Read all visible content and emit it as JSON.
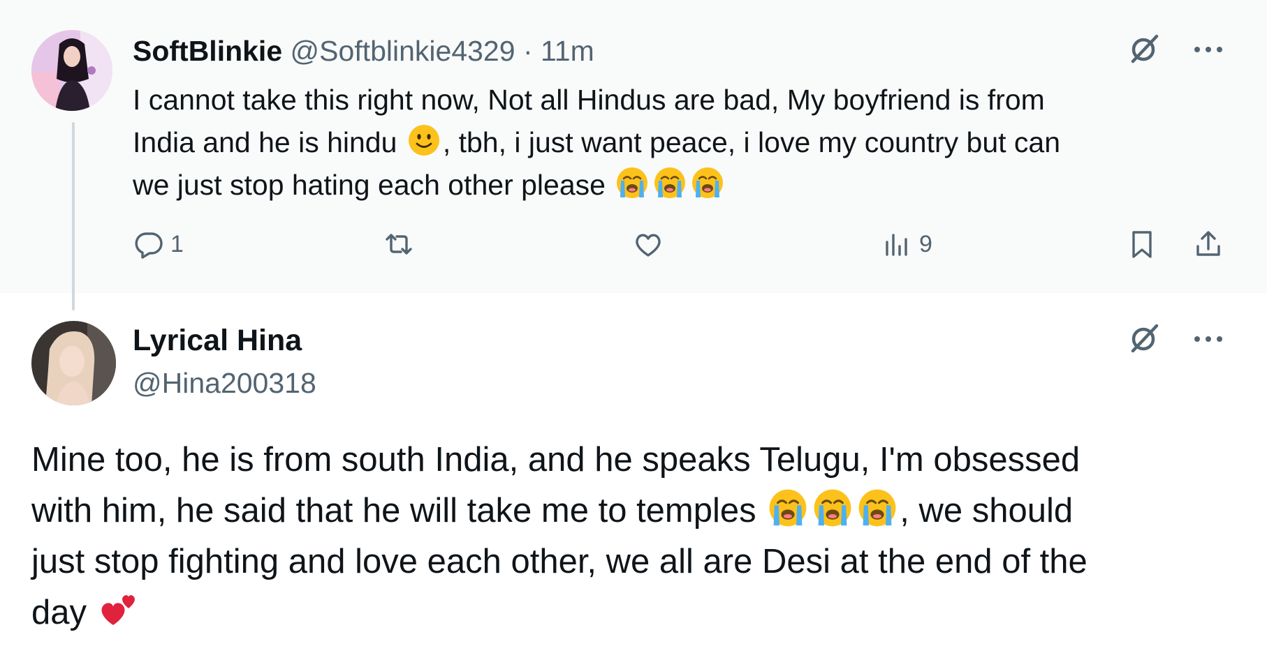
{
  "tweet1": {
    "display_name": "SoftBlinkie",
    "handle": "@Softblinkie4329",
    "separator": "·",
    "time": "11m",
    "text_line1": "I cannot take this right now, Not all Hindus are bad, My boyfriend is from",
    "text_line2a": "India and he is hindu ",
    "text_line2b": ", tbh, i just want peace, i love my country but can",
    "text_line3": "we just stop hating each other please ",
    "reply_count": "1",
    "views_count": "9"
  },
  "tweet2": {
    "display_name": "Lyrical Hina",
    "handle": "@Hina200318",
    "text_line1": "Mine too, he is from south India, and he speaks Telugu, I'm obsessed",
    "text_line2a": "with him, he said that he will take me to temples ",
    "text_line2b": ", we should",
    "text_line3": "just stop fighting and love each other, we all are Desi at the end of the",
    "text_line4": "day "
  },
  "icons": {
    "reply": "reply-icon",
    "retweet": "retweet-icon",
    "like": "heart-icon",
    "views": "views-icon",
    "bookmark": "bookmark-icon",
    "share": "share-icon",
    "grok": "grok-icon",
    "more": "more-icon",
    "emoji_smile": "slightly-smiling-face-emoji",
    "emoji_cry": "loudly-crying-face-emoji",
    "emoji_hearts": "two-hearts-emoji"
  },
  "colors": {
    "text": "#0f1419",
    "secondary": "#536471",
    "thread_line": "#cfd9de",
    "tweet1_background": "#f9fafa"
  }
}
